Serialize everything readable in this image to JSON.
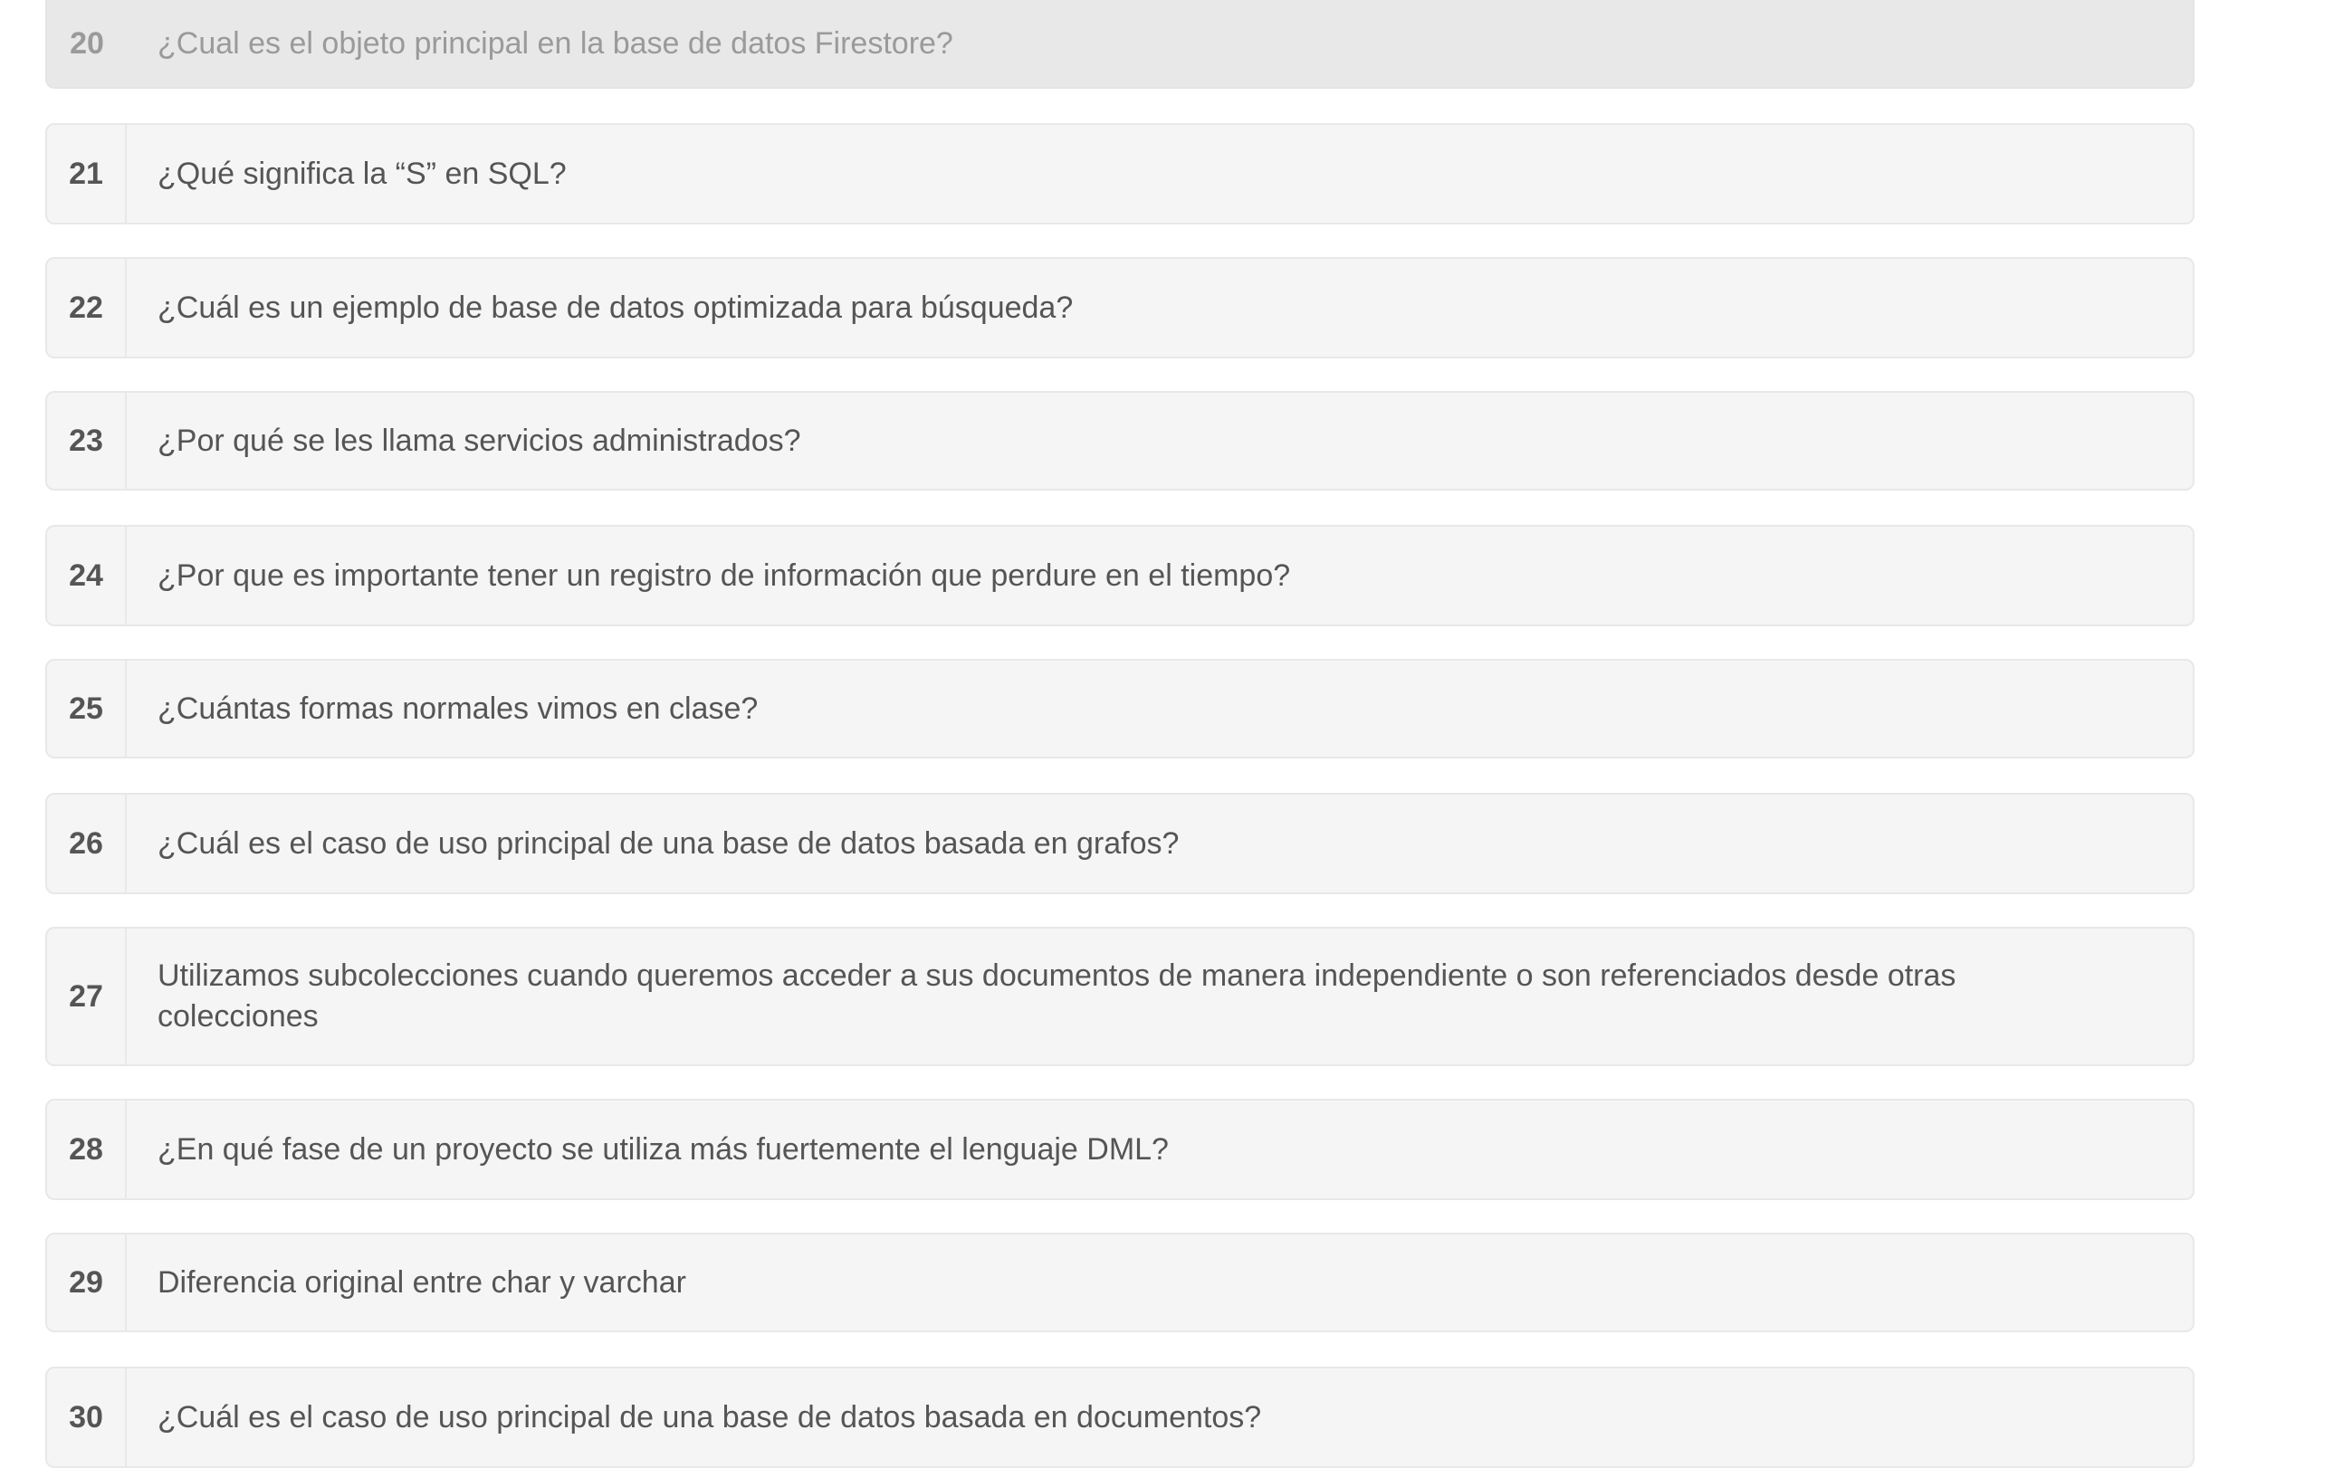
{
  "questions": [
    {
      "number": "20",
      "text": "¿Cual es el objeto principal en la base de datos Firestore?",
      "state": "active"
    },
    {
      "number": "21",
      "text": "¿Qué significa la “S” en SQL?",
      "state": "default"
    },
    {
      "number": "22",
      "text": "¿Cuál es un ejemplo de base de datos optimizada para búsqueda?",
      "state": "default"
    },
    {
      "number": "23",
      "text": "¿Por qué se les llama servicios administrados?",
      "state": "default"
    },
    {
      "number": "24",
      "text": "¿Por que es importante tener un registro de información que perdure en el tiempo?",
      "state": "default"
    },
    {
      "number": "25",
      "text": "¿Cuántas formas normales vimos en clase?",
      "state": "default"
    },
    {
      "number": "26",
      "text": "¿Cuál es el caso de uso principal de una base de datos basada en grafos?",
      "state": "default"
    },
    {
      "number": "27",
      "text": "Utilizamos subcolecciones cuando queremos acceder a sus documentos de manera independiente o son referenciados desde otras colecciones",
      "state": "default"
    },
    {
      "number": "28",
      "text": "¿En qué fase de un proyecto se utiliza más fuertemente el lenguaje DML?",
      "state": "default"
    },
    {
      "number": "29",
      "text": "Diferencia original entre char y varchar",
      "state": "default"
    },
    {
      "number": "30",
      "text": "¿Cuál es el caso de uso principal de una base de datos basada en documentos?",
      "state": "default"
    }
  ],
  "colors": {
    "row_background": "#f5f5f5",
    "row_active_background": "#e8e8e8",
    "border": "#e8e8e8",
    "text": "#555555",
    "text_muted": "#9a9a9a"
  }
}
